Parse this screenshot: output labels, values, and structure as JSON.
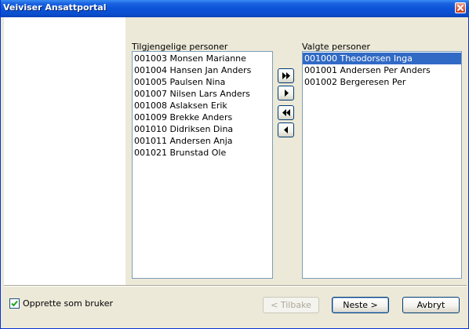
{
  "window": {
    "title": "Veiviser Ansattportal"
  },
  "available": {
    "label": "Tilgjengelige personer",
    "items": [
      "001003 Monsen Marianne",
      "001004 Hansen Jan Anders",
      "001005 Paulsen Nina",
      "001007 Nilsen Lars Anders",
      "001008 Aslaksen Erik",
      "001009 Brekke Anders",
      "001010 Didriksen Dina",
      "001011 Andersen Anja",
      "001021 Brunstad Ole"
    ]
  },
  "selected": {
    "label": "Valgte personer",
    "items": [
      "001000 Theodorsen Inga",
      "001001 Andersen Per Anders",
      "001002 Bergeresen Per"
    ],
    "highlighted_index": 0
  },
  "transfer_buttons": [
    {
      "icon": "double-arrow-right-icon"
    },
    {
      "icon": "arrow-right-icon"
    },
    {
      "icon": "double-arrow-left-icon"
    },
    {
      "icon": "arrow-left-icon"
    }
  ],
  "footer": {
    "checkbox_label": "Opprette som bruker",
    "checkbox_checked": true,
    "back_label": "< Tilbake",
    "next_label": "Neste >",
    "cancel_label": "Avbryt"
  },
  "colors": {
    "titlebar": "#0b53d8",
    "selection": "#316ac5",
    "list_border": "#7f9db9",
    "dialog_bg": "#ece9d8"
  }
}
